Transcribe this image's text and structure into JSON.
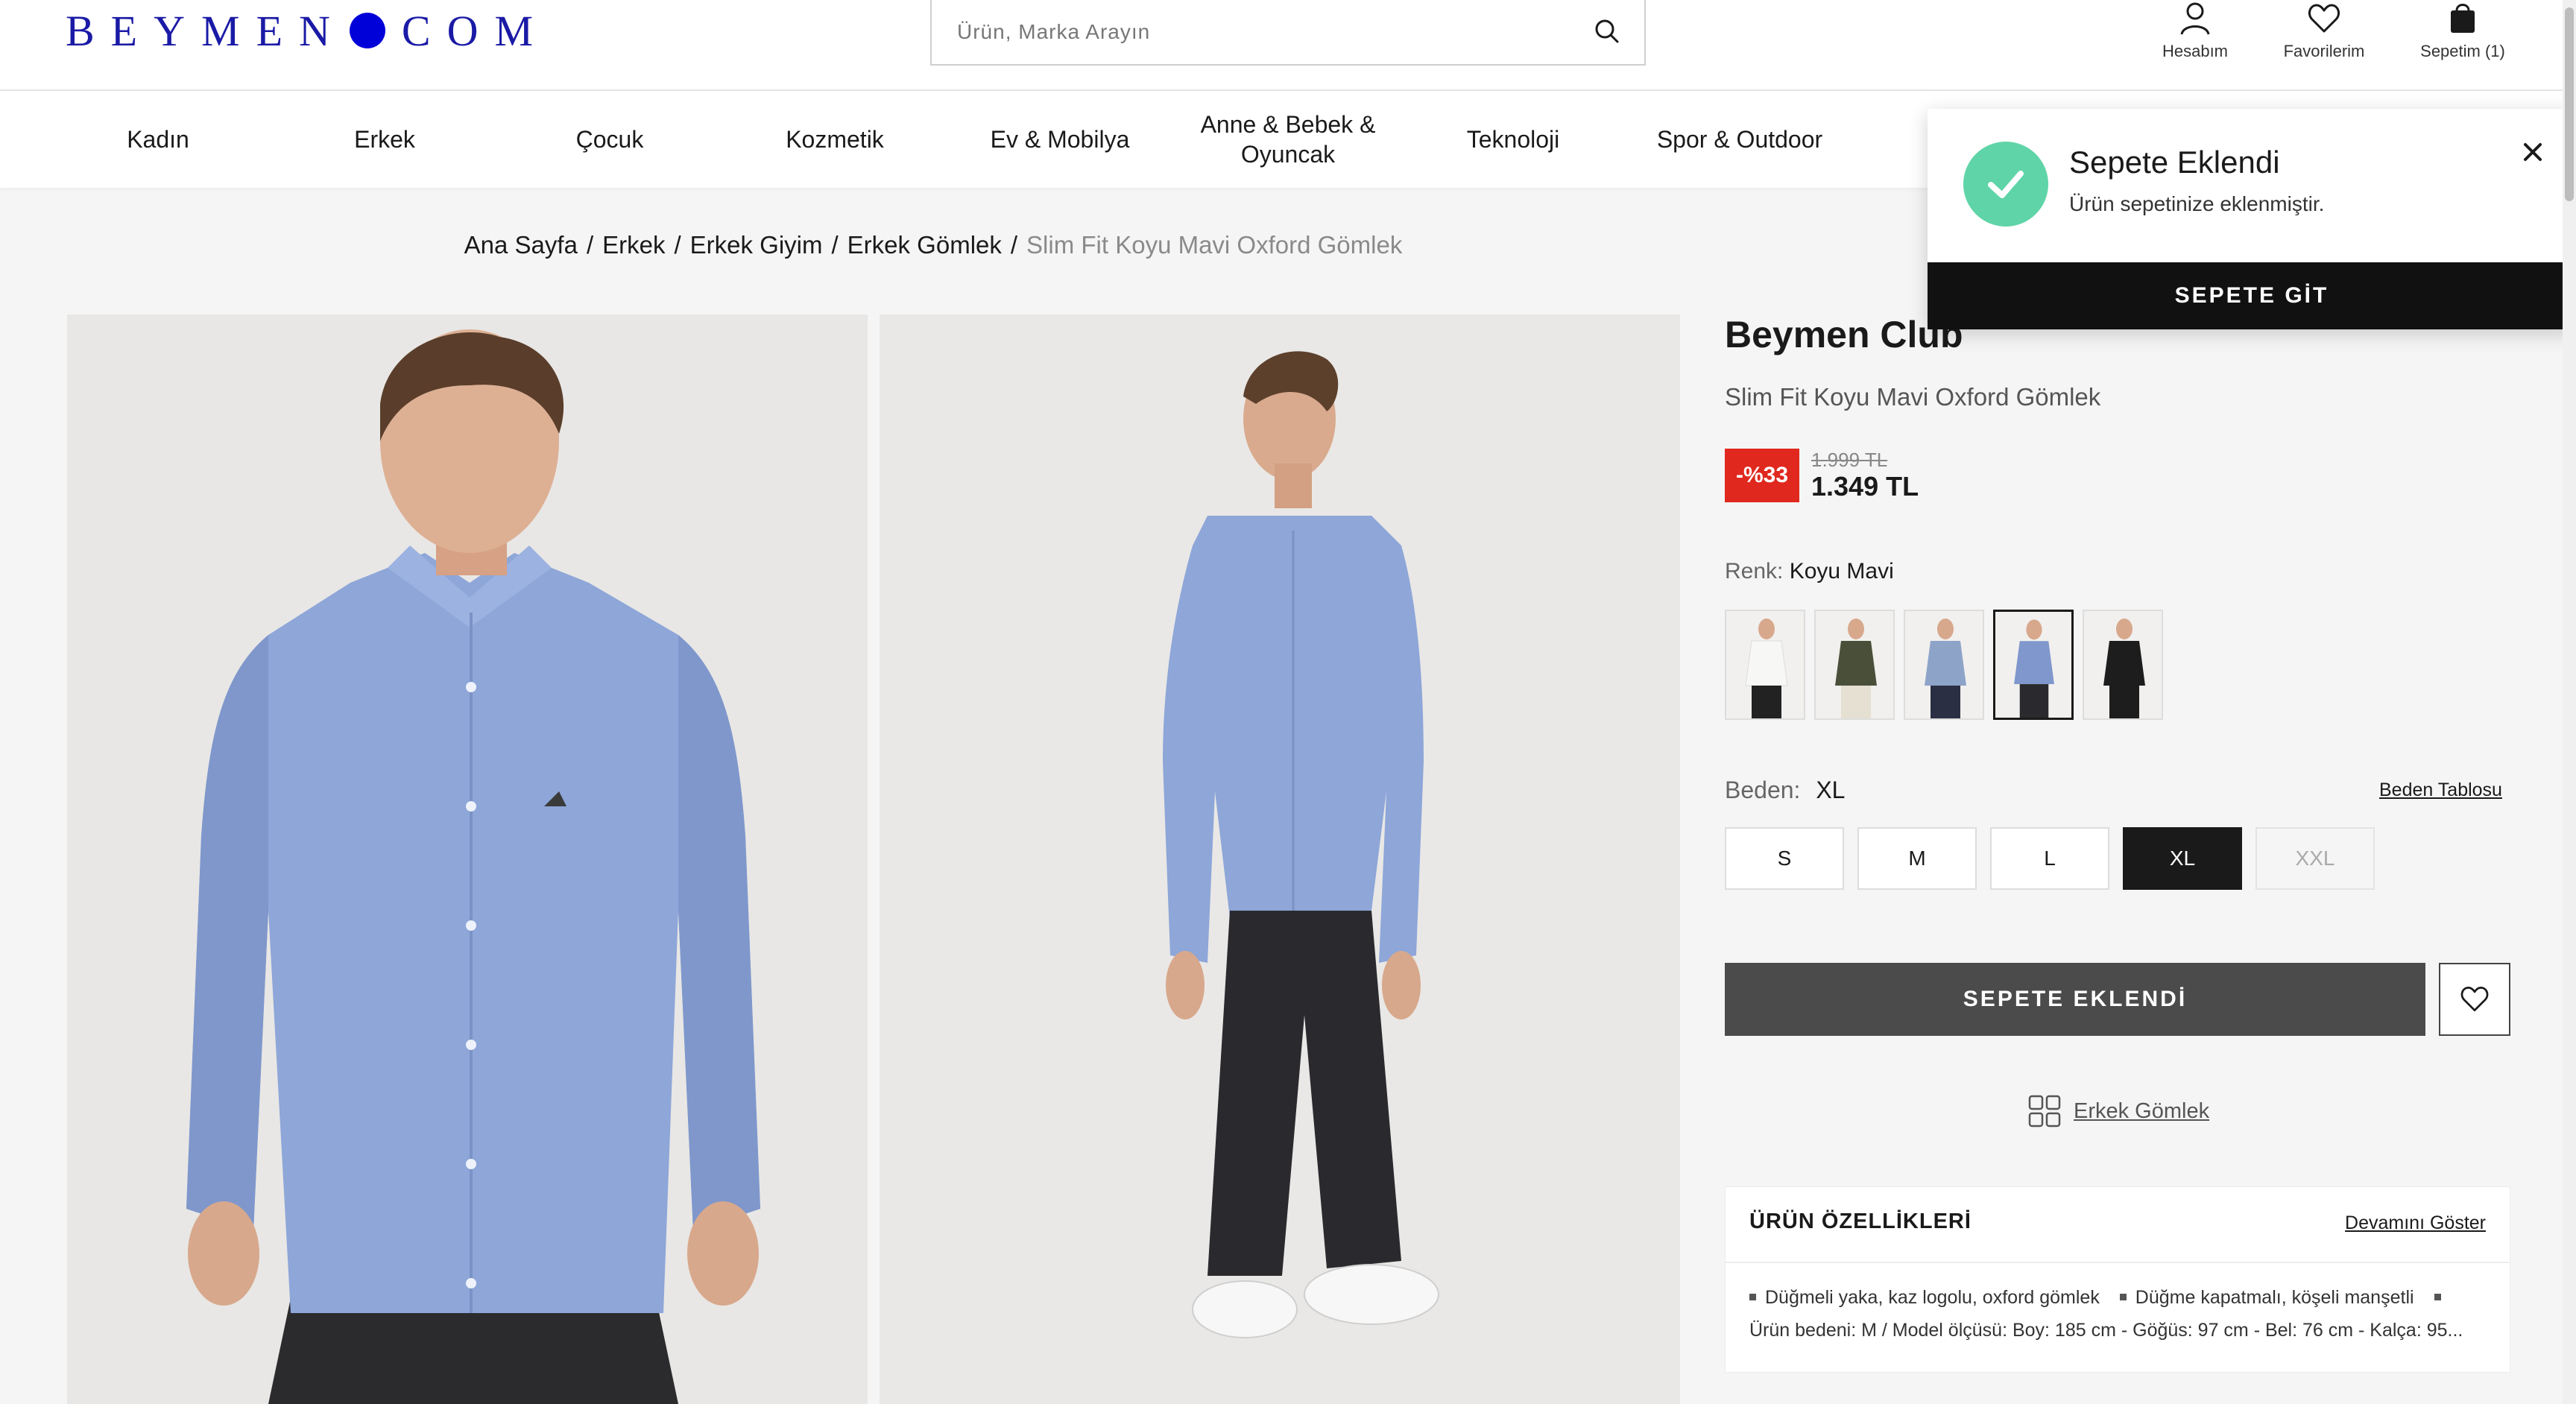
{
  "header": {
    "logo_left": "BEYMEN",
    "logo_right": "COM",
    "search_placeholder": "Ürün, Marka Arayın",
    "account_label": "Hesabım",
    "favorites_label": "Favorilerim",
    "cart_label": "Sepetim (1)"
  },
  "nav": {
    "items": [
      "Kadın",
      "Erkek",
      "Çocuk",
      "Kozmetik",
      "Ev & Mobilya",
      "Anne & Bebek & Oyuncak",
      "Teknoloji",
      "Spor & Outdoor"
    ]
  },
  "breadcrumb": {
    "items": [
      "Ana Sayfa",
      "Erkek",
      "Erkek Giyim",
      "Erkek Gömlek"
    ],
    "current": "Slim Fit Koyu Mavi Oxford Gömlek",
    "separator": "/"
  },
  "product": {
    "brand": "Beymen Club",
    "name": "Slim Fit Koyu Mavi Oxford Gömlek",
    "discount": "-%33",
    "old_price": "1.999 TL",
    "new_price": "1.349 TL",
    "color_label": "Renk:",
    "color_value": "Koyu Mavi",
    "size_label": "Beden:",
    "size_value": "XL",
    "size_table_link": "Beden Tablosu",
    "sizes": [
      "S",
      "M",
      "L",
      "XL",
      "XXL"
    ],
    "add_button": "SEPETE EKLENDİ",
    "category_link": "Erkek Gömlek",
    "swatch_colors": [
      "#f4f4f2",
      "#4a4f3a",
      "#8ea3c8",
      "#7f97cc",
      "#1d1d1d"
    ]
  },
  "features": {
    "title": "ÜRÜN ÖZELLİKLERİ",
    "more_link": "Devamını Göster",
    "bullet1": "Düğmeli yaka, kaz logolu, oxford gömlek",
    "bullet2": "Düğme kapatmalı, köşeli manşetli",
    "line2": "Ürün bedeni: M / Model ölçüsü: Boy: 185 cm - Göğüs: 97 cm - Bel: 76 cm - Kalça: 95..."
  },
  "toast": {
    "title": "Sepete Eklendi",
    "message": "Ürün sepetinize eklenmiştir.",
    "button": "SEPETE GİT"
  },
  "colors": {
    "brand_blue": "#0000d8",
    "discount_red": "#e0281e",
    "success_green": "#5fd4a8",
    "shirt_blue": "#8ca5d6"
  }
}
